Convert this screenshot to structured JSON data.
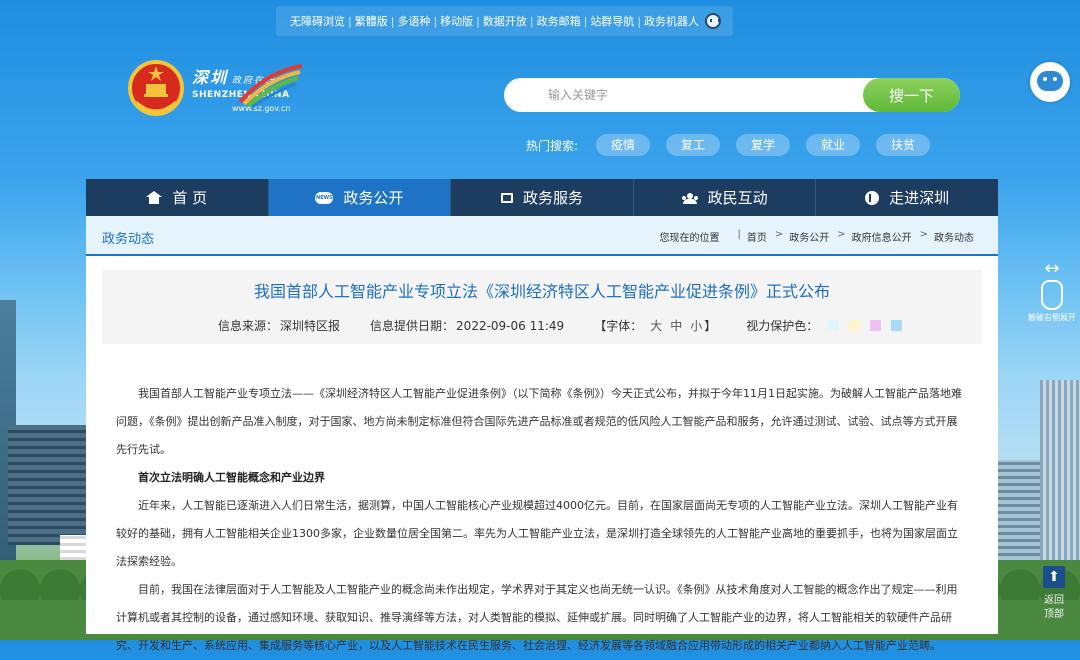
{
  "top_links": [
    "无障碍浏览",
    "繁體版",
    "多语种",
    "移动版",
    "数据开放",
    "政务邮箱",
    "站群导航",
    "政务机器人"
  ],
  "logo": {
    "cn": "深圳",
    "cn_small": "政府在线",
    "en": "SHENZHEN CHINA",
    "url": "www.sz.gov.cn"
  },
  "search": {
    "placeholder": "输入关键字",
    "button": "搜一下"
  },
  "hot": {
    "label": "热门搜索:",
    "tags": [
      "疫情",
      "复工",
      "复学",
      "就业",
      "扶贫"
    ]
  },
  "side": {
    "swipe_label": "触碰右侧展开",
    "back_top": "返回顶部"
  },
  "nav": {
    "items": [
      {
        "label": "首 页",
        "icon": "home-icon"
      },
      {
        "label": "政务公开",
        "icon": "news-icon"
      },
      {
        "label": "政务服务",
        "icon": "service-icon"
      },
      {
        "label": "政民互动",
        "icon": "people-icon"
      },
      {
        "label": "走进深圳",
        "icon": "explore-icon"
      }
    ],
    "active_index": 1,
    "news_icon_text": "NEWS"
  },
  "breadcrumb": {
    "section": "政务动态",
    "prefix": "您现在的位置",
    "items": [
      "首页",
      "政务公开",
      "政府信息公开",
      "政务动态"
    ]
  },
  "article": {
    "title": "我国首部人工智能产业专项立法《深圳经济特区人工智能产业促进条例》正式公布",
    "source_label": "信息来源：",
    "source": "深圳特区报",
    "date_label": "信息提供日期：",
    "date": "2022-09-06 11:49",
    "font_label": "【字体：",
    "font_sizes": [
      "大",
      "中",
      "小"
    ],
    "font_close": "】",
    "vision_label": "视力保护色：",
    "vision_colors": [
      "#dff4fb",
      "#fbf7c9",
      "#eec3f3",
      "#a7dbf5"
    ],
    "paragraphs": [
      {
        "text": "我国首部人工智能产业专项立法——《深圳经济特区人工智能产业促进条例》（以下简称《条例》）今天正式公布，并拟于今年11月1日起实施。为破解人工智能产品落地难问题，《条例》提出创新产品准入制度，对于国家、地方尚未制定标准但符合国际先进产品标准或者规范的低风险人工智能产品和服务，允许通过测试、试验、试点等方式开展先行先试。",
        "bold": false
      },
      {
        "text": "首次立法明确人工智能概念和产业边界",
        "bold": true
      },
      {
        "text": "近年来，人工智能已逐渐进入人们日常生活，据测算，中国人工智能核心产业规模超过4000亿元。目前，在国家层面尚无专项的人工智能产业立法。深圳人工智能产业有较好的基础，拥有人工智能相关企业1300多家，企业数量位居全国第二。率先为人工智能产业立法，是深圳打造全球领先的人工智能产业高地的重要抓手，也将为国家层面立法探索经验。",
        "bold": false
      },
      {
        "text": "目前，我国在法律层面对于人工智能及人工智能产业的概念尚未作出规定，学术界对于其定义也尚无统一认识。《条例》从技术角度对人工智能的概念作出了规定——利用计算机或者其控制的设备，通过感知环境、获取知识、推导演绎等方法，对人类智能的模拟、延伸或扩展。同时明确了人工智能产业的边界，将人工智能相关的软硬件产品研究、开发和生产、系统应用、集成服务等核心产业，以及人工智能技术在民生服务、社会治理、经济发展等各领域融合应用带动形成的相关产业都纳入人工智能产业范畴。",
        "bold": false
      }
    ]
  }
}
